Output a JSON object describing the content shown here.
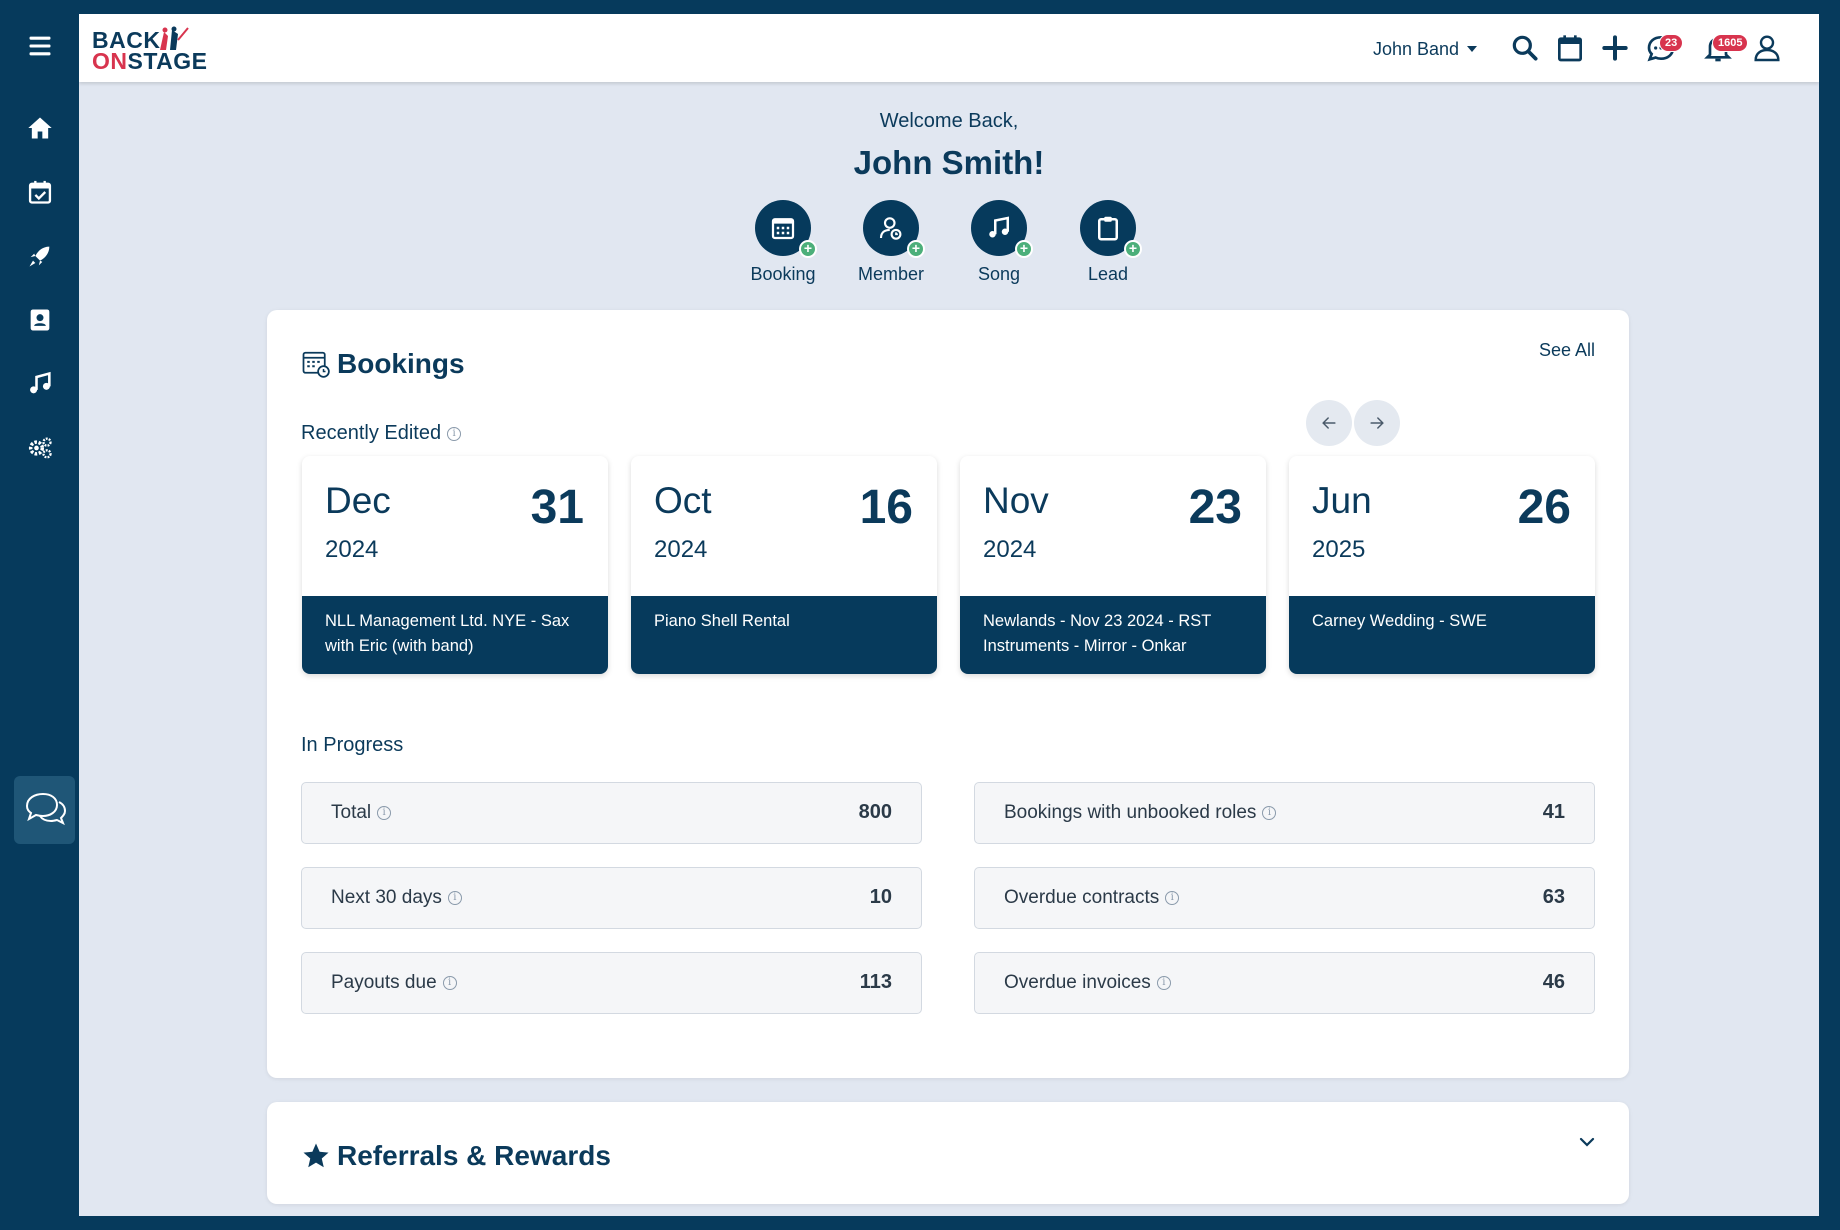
{
  "brand": {
    "line1": "BACK",
    "on": "ON",
    "stage": "STAGE",
    "accent": "#d8344e",
    "navy": "#063a5c"
  },
  "sidebar": {
    "items": [
      {
        "name": "home-icon"
      },
      {
        "name": "calendar-check-icon"
      },
      {
        "name": "rocket-icon"
      },
      {
        "name": "contacts-icon"
      },
      {
        "name": "music-icon"
      },
      {
        "name": "settings-gears-icon"
      }
    ],
    "chat": "chat-bubbles-icon"
  },
  "header": {
    "account_name": "John Band",
    "messages_badge": "23",
    "notifications_badge": "1605"
  },
  "welcome": {
    "greeting": "Welcome Back,",
    "name": "John Smith!"
  },
  "quick_actions": [
    {
      "label": "Booking",
      "icon": "calendar-icon"
    },
    {
      "label": "Member",
      "icon": "member-icon"
    },
    {
      "label": "Song",
      "icon": "music-note-icon"
    },
    {
      "label": "Lead",
      "icon": "clipboard-icon"
    }
  ],
  "bookings": {
    "title": "Bookings",
    "see_all": "See All",
    "recently_edited_label": "Recently Edited",
    "recent": [
      {
        "month": "Dec",
        "day": "31",
        "year": "2024",
        "title": "NLL Management Ltd. NYE - Sax with Eric (with band)"
      },
      {
        "month": "Oct",
        "day": "16",
        "year": "2024",
        "title": "Piano Shell Rental"
      },
      {
        "month": "Nov",
        "day": "23",
        "year": "2024",
        "title": "Newlands - Nov 23 2024 - RST Instruments - Mirror - Onkar"
      },
      {
        "month": "Jun",
        "day": "26",
        "year": "2025",
        "title": "Carney Wedding - SWE"
      }
    ],
    "in_progress_label": "In Progress",
    "stats": [
      {
        "label": "Total",
        "value": "800"
      },
      {
        "label": "Bookings with unbooked roles",
        "value": "41"
      },
      {
        "label": "Next 30 days",
        "value": "10"
      },
      {
        "label": "Overdue contracts",
        "value": "63"
      },
      {
        "label": "Payouts due",
        "value": "113"
      },
      {
        "label": "Overdue invoices",
        "value": "46"
      }
    ]
  },
  "referrals": {
    "title": "Referrals & Rewards"
  }
}
